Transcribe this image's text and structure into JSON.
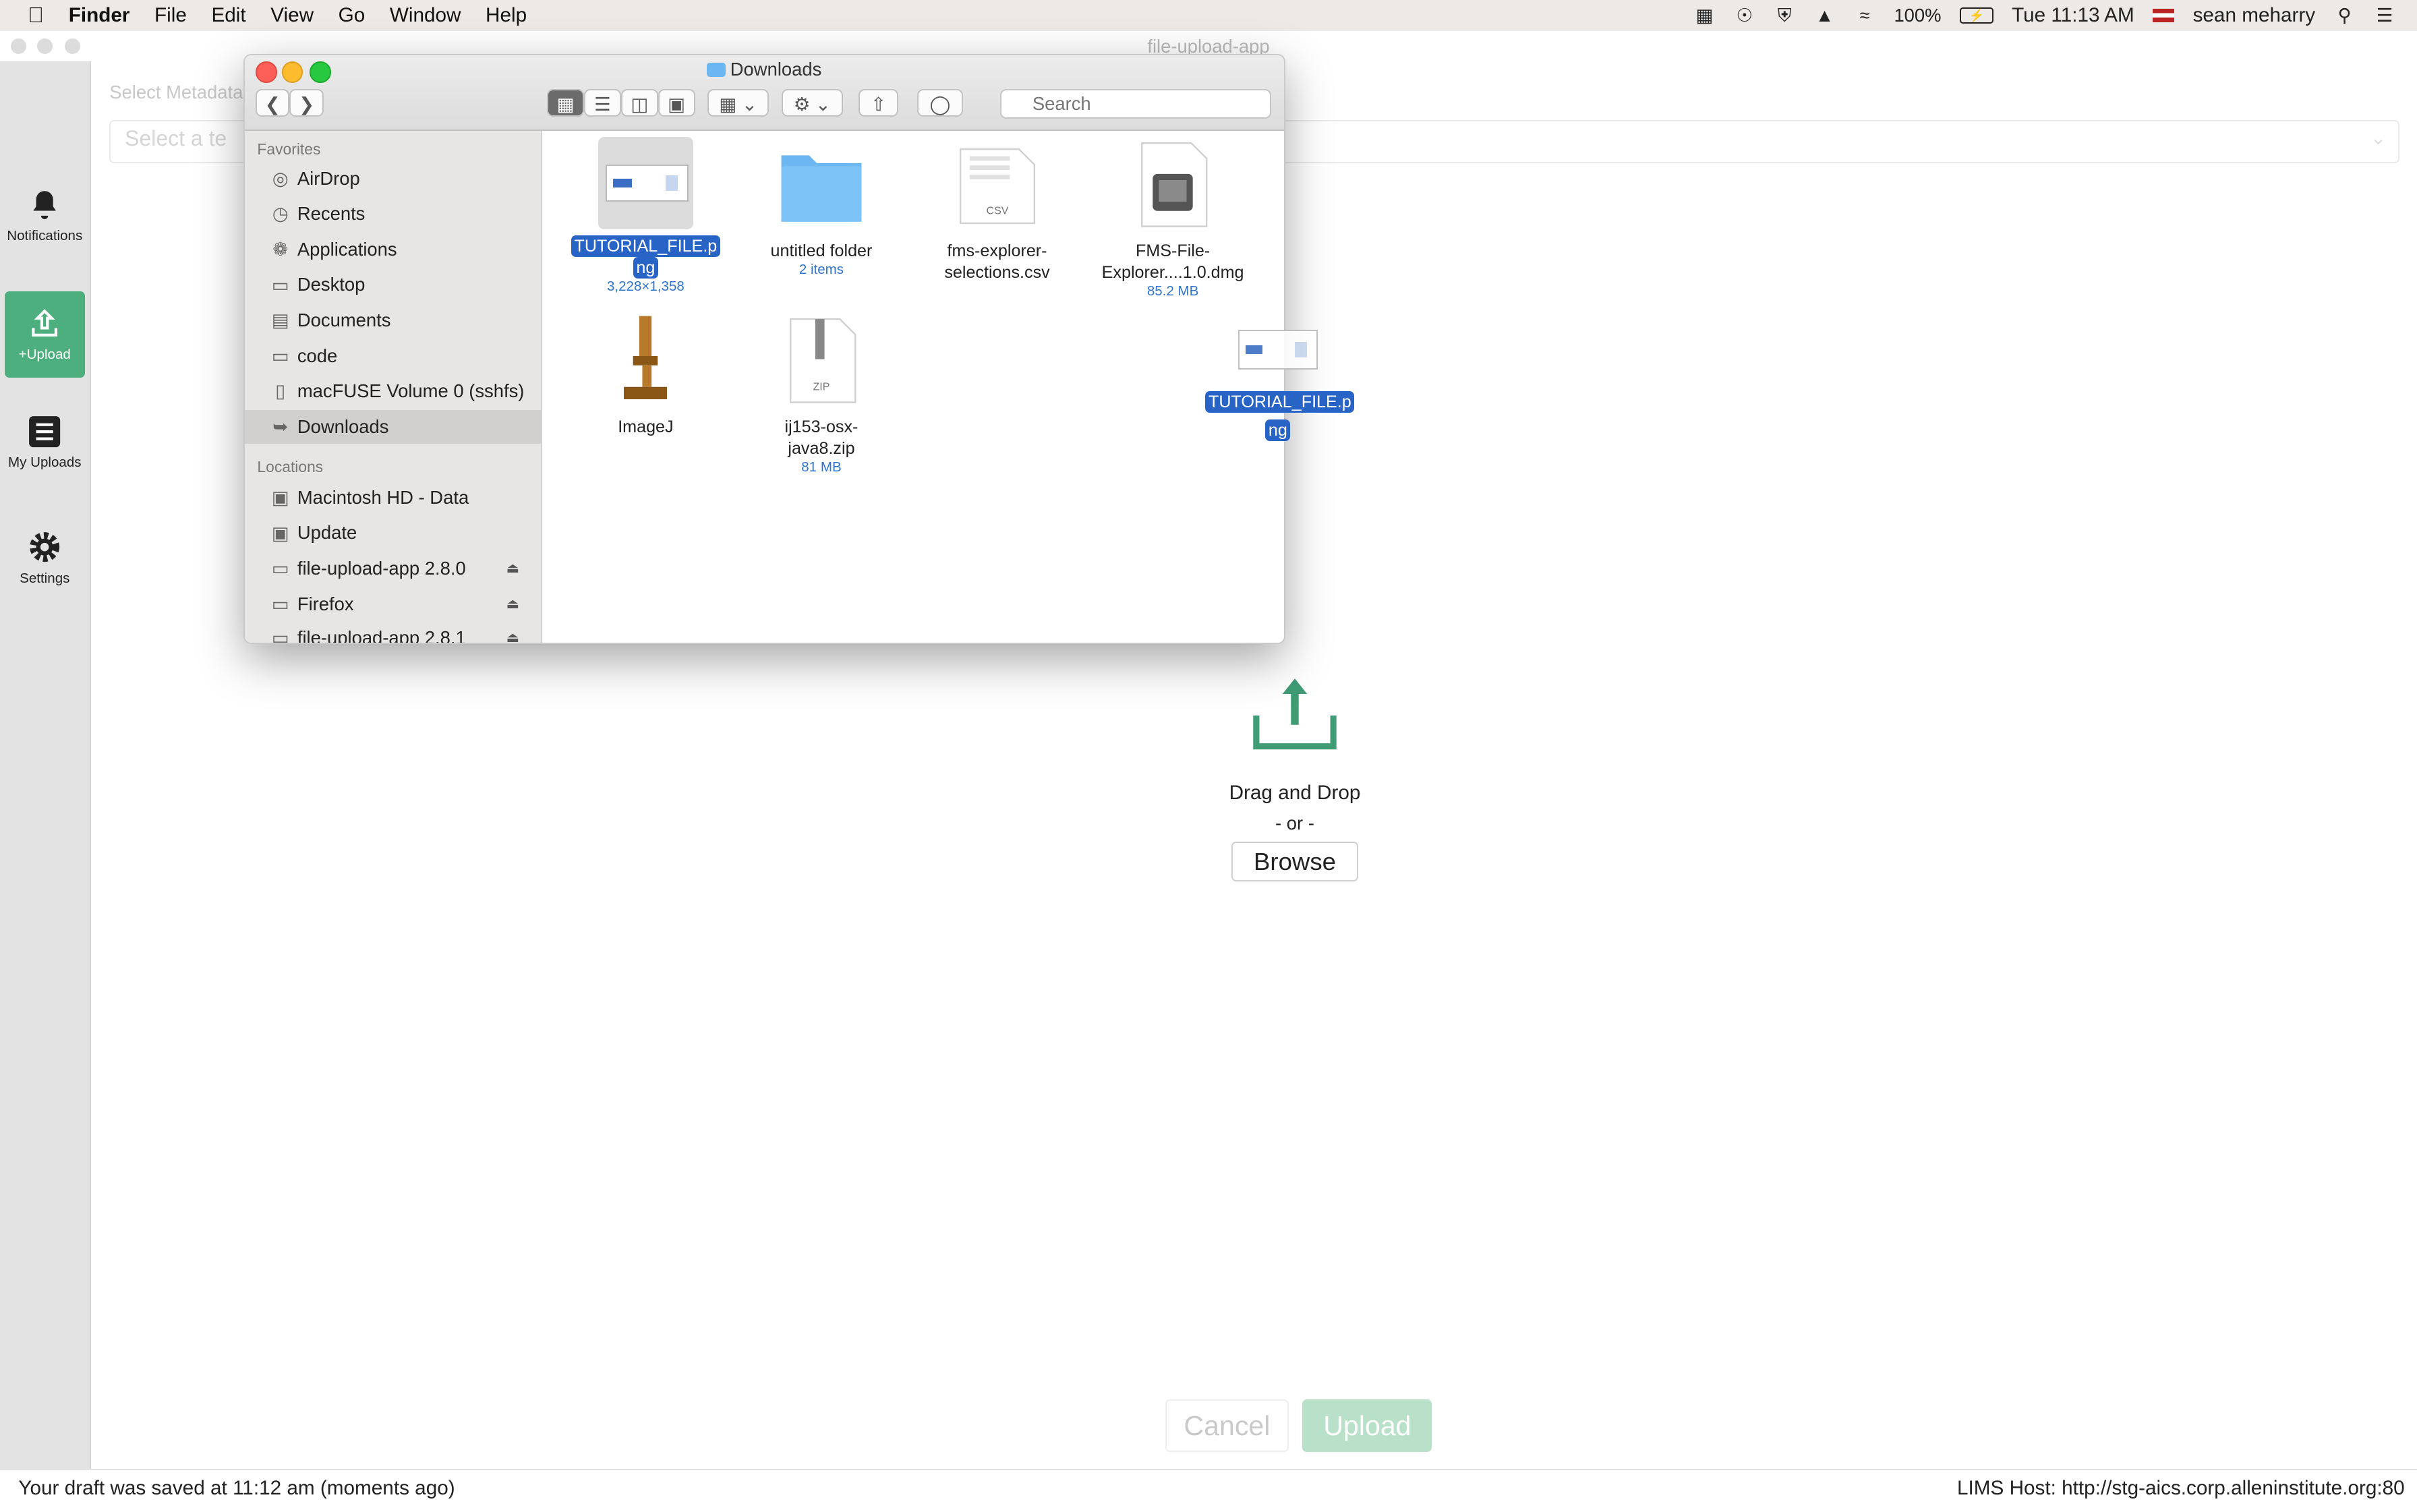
{
  "menubar": {
    "app_name": "Finder",
    "menus": [
      "File",
      "Edit",
      "View",
      "Go",
      "Window",
      "Help"
    ],
    "battery": "100%",
    "clock": "Tue 11:13 AM",
    "user": "sean meharry"
  },
  "app": {
    "window_title": "file-upload-app",
    "nav": {
      "notifications": "Notifications",
      "upload": "+Upload",
      "my_uploads": "My Uploads",
      "settings": "Settings"
    },
    "metadata_label": "Select Metadata",
    "metadata_placeholder": "Select a te",
    "drop": {
      "title": "Drag and Drop",
      "or": "- or -",
      "browse_label": "Browse"
    },
    "cancel_label": "Cancel",
    "upload_label": "Upload",
    "status": {
      "draft": "Your draft was saved at 11:12 am (moments ago)",
      "lims": "LIMS Host: http://stg-aics.corp.alleninstitute.org:80"
    },
    "accent_color": "#4caf7d"
  },
  "finder": {
    "title": "Downloads",
    "search_placeholder": "Search",
    "favorites_header": "Favorites",
    "locations_header": "Locations",
    "favorites": [
      {
        "label": "AirDrop",
        "icon": "airdrop-icon"
      },
      {
        "label": "Recents",
        "icon": "clock-icon"
      },
      {
        "label": "Applications",
        "icon": "applications-icon"
      },
      {
        "label": "Desktop",
        "icon": "desktop-icon"
      },
      {
        "label": "Documents",
        "icon": "document-icon"
      },
      {
        "label": "code",
        "icon": "folder-icon"
      },
      {
        "label": "macFUSE Volume 0 (sshfs)",
        "icon": "document-icon"
      },
      {
        "label": "Downloads",
        "icon": "download-icon"
      }
    ],
    "locations": [
      {
        "label": "Macintosh HD - Data",
        "icon": "disk-icon"
      },
      {
        "label": "Update",
        "icon": "disk-icon"
      },
      {
        "label": "file-upload-app 2.8.0",
        "icon": "disk-icon"
      },
      {
        "label": "Firefox",
        "icon": "disk-icon"
      },
      {
        "label": "file-upload-app 2.8.1",
        "icon": "disk-icon"
      }
    ],
    "files": [
      {
        "name_line1": "TUTORIAL_FILE.p",
        "name_line2": "ng",
        "meta": "3,228×1,358"
      },
      {
        "name_line1": "untitled folder",
        "name_line2": "",
        "meta": "2 items"
      },
      {
        "name_line1": "fms-explorer-",
        "name_line2": "selections.csv",
        "meta": ""
      },
      {
        "name_line1": "FMS-File-",
        "name_line2": "Explorer....1.0.dmg",
        "meta": "85.2 MB"
      },
      {
        "name_line1": "ImageJ",
        "name_line2": "",
        "meta": ""
      },
      {
        "name_line1": "ij153-osx-",
        "name_line2": "java8.zip",
        "meta": "81 MB"
      }
    ],
    "csv_badge": "CSV",
    "zip_badge": "ZIP"
  },
  "drag_ghost": {
    "name_line1": "TUTORIAL_FILE.p",
    "name_line2": "ng"
  }
}
